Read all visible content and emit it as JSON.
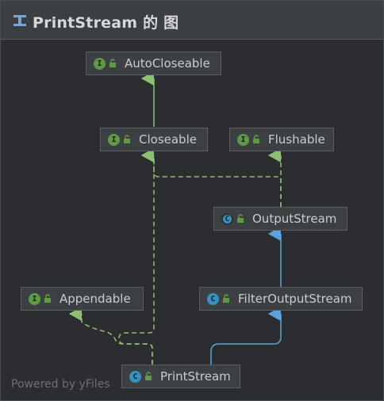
{
  "window": {
    "title": "PrintStream 的 图",
    "title_icon": "diagram-icon"
  },
  "nodes": [
    {
      "id": "autocloseable",
      "label": "AutoCloseable",
      "kind": "interface"
    },
    {
      "id": "closeable",
      "label": "Closeable",
      "kind": "interface"
    },
    {
      "id": "flushable",
      "label": "Flushable",
      "kind": "interface"
    },
    {
      "id": "outputstream",
      "label": "OutputStream",
      "kind": "abstract-class"
    },
    {
      "id": "appendable",
      "label": "Appendable",
      "kind": "interface"
    },
    {
      "id": "filteroutputstream",
      "label": "FilterOutputStream",
      "kind": "class"
    },
    {
      "id": "printstream",
      "label": "PrintStream",
      "kind": "class"
    }
  ],
  "badges": {
    "interface": "I",
    "class": "C",
    "abstract-class": "C"
  },
  "edges": [
    {
      "from": "closeable",
      "to": "autocloseable",
      "type": "extends"
    },
    {
      "from": "outputstream",
      "to": "closeable",
      "type": "implements"
    },
    {
      "from": "outputstream",
      "to": "flushable",
      "type": "implements"
    },
    {
      "from": "filteroutputstream",
      "to": "outputstream",
      "type": "extends"
    },
    {
      "from": "printstream",
      "to": "filteroutputstream",
      "type": "extends"
    },
    {
      "from": "printstream",
      "to": "appendable",
      "type": "implements"
    },
    {
      "from": "printstream",
      "to": "closeable",
      "type": "implements"
    }
  ],
  "colors": {
    "interface_badge": "#5f9b46",
    "class_badge": "#3592c4",
    "extends_interface_line": "#8fbf73",
    "extends_class_line": "#5aa3e0",
    "implements_line": "#8fbf73"
  },
  "footer": "Powered by yFiles"
}
